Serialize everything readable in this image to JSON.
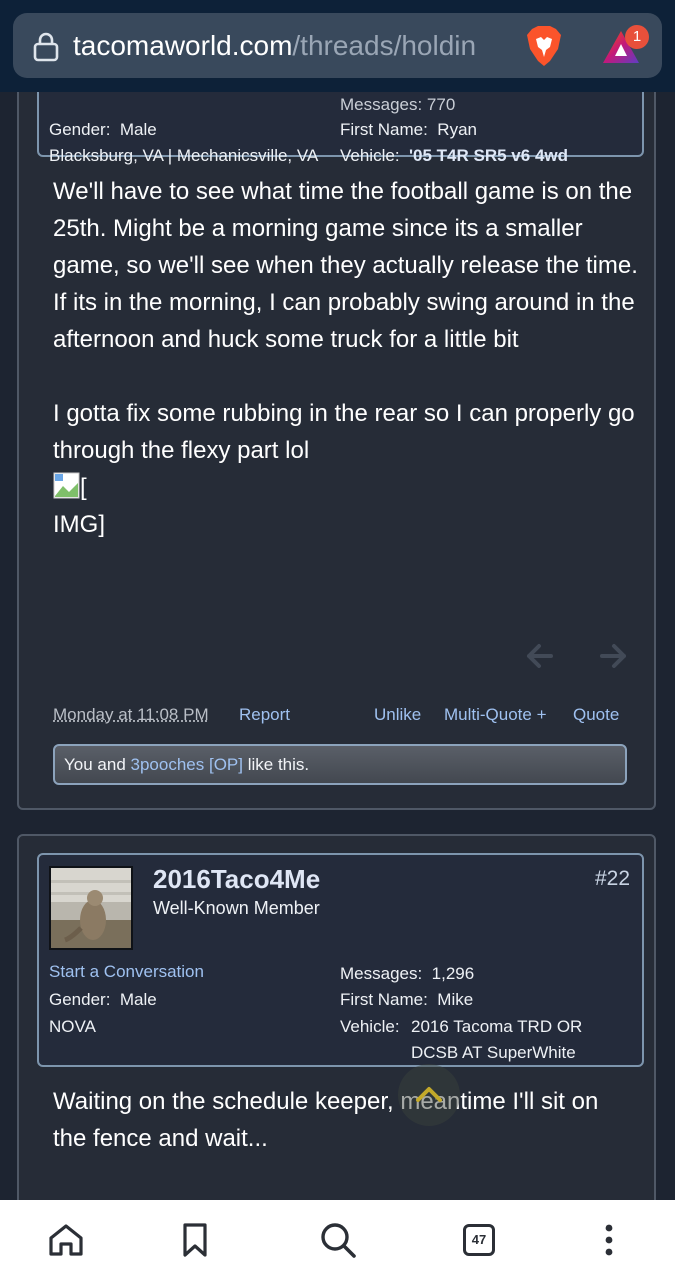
{
  "browser": {
    "url_domain": "tacomaworld.com",
    "url_path": "/threads/holdin",
    "rewards_badge": "1",
    "tab_count": "47"
  },
  "post1": {
    "messages_partial": "Messages:  770",
    "gender_label": "Gender:",
    "gender_value": "Male",
    "location": "Blacksburg, VA | Mechanicsville, VA",
    "first_name_label": "First Name:",
    "first_name_value": "Ryan",
    "vehicle_label": "Vehicle:",
    "vehicle_value": "'05 T4R SR5 v6 4wd",
    "body_paragraph1": "We'll have to see what time the football game is on the 25th. Might be a morning game since its a smaller game, so we'll see when they actually release the time. If its in the morning, I can probably swing around in the afternoon and huck some truck for a little bit",
    "body_paragraph2": "I gotta fix some rubbing in the rear so I can properly go through the flexy part lol",
    "img_alt_line1": "[",
    "img_alt_line2": "IMG]",
    "timestamp": "Monday at 11:08 PM",
    "report": "Report",
    "unlike": "Unlike",
    "multiquote": "Multi-Quote +",
    "quote": "Quote",
    "likes_prefix": "You and",
    "likes_user": "3pooches [OP]",
    "likes_suffix": "like this."
  },
  "post2": {
    "username": "2016Taco4Me",
    "rank": "Well-Known Member",
    "post_number": "#22",
    "start_conversation": "Start a Conversation",
    "gender_label": "Gender:",
    "gender_value": "Male",
    "location": "NOVA",
    "messages_label": "Messages:",
    "messages_value": "1,296",
    "first_name_label": "First Name:",
    "first_name_value": "Mike",
    "vehicle_label": "Vehicle:",
    "vehicle_line1": "2016 Tacoma TRD OR",
    "vehicle_line2": "DCSB AT SuperWhite",
    "body": "Waiting on the schedule keeper, meantime I'll sit on the fence and wait..."
  },
  "colors": {
    "page_bg": "#1d2431",
    "card_bg": "#262c37",
    "link": "#9fc1f0",
    "accent_badge": "#e8503b"
  },
  "icons": [
    "lock-icon",
    "brave-lion-icon",
    "brave-rewards-icon",
    "arrow-left-icon",
    "arrow-right-icon",
    "chevron-up-icon",
    "home-icon",
    "bookmark-icon",
    "search-icon",
    "tabs-icon",
    "more-vert-icon"
  ]
}
